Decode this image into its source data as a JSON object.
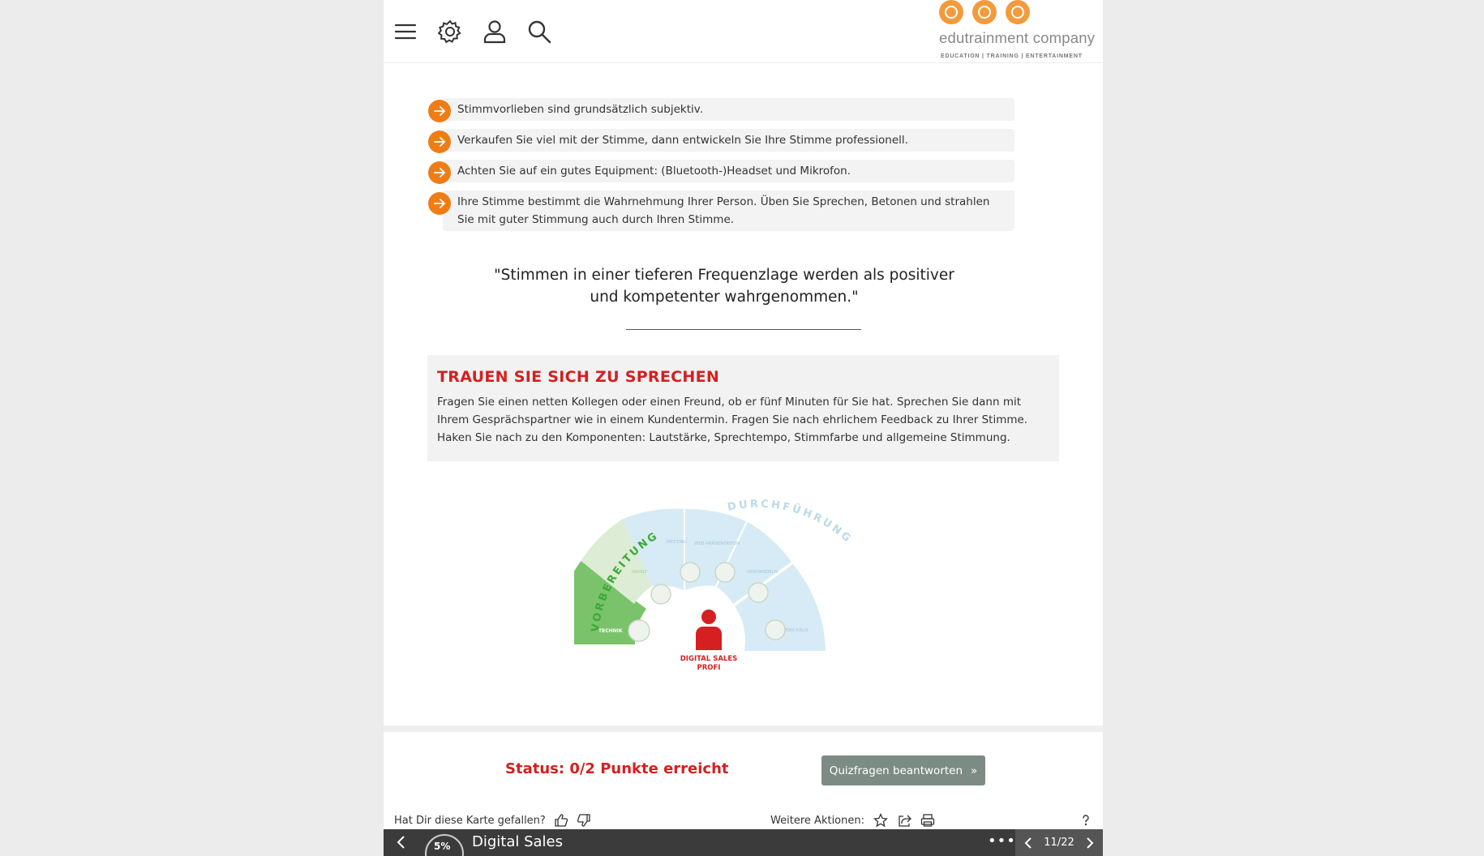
{
  "header": {
    "icons": [
      "menu-icon",
      "gear-icon",
      "user-icon",
      "search-icon"
    ],
    "logo": {
      "name": "edutrainment company",
      "tagline": "EDUCATION | TRAINING | ENTERTAINMENT"
    }
  },
  "bullets": [
    "Stimmvorlieben sind grundsätzlich subjektiv.",
    "Verkaufen Sie viel mit der Stimme, dann entwickeln Sie Ihre Stimme professionell.",
    "Achten Sie auf ein gutes Equipment: (Bluetooth-)Headset und Mikrofon.",
    "Ihre Stimme bestimmt die Wahrnehmung Ihrer Person. Üben Sie Sprechen, Betonen und strahlen Sie mit guter Stimmung auch durch Ihren Stimme."
  ],
  "quote": {
    "line1": "\"Stimmen in einer tieferen Frequenzlage werden als positiver",
    "line2": "und kompetenter wahrgenommen.\""
  },
  "infobox": {
    "title": "TRAUEN SIE SICH ZU SPRECHEN",
    "text": "Fragen Sie einen netten Kollegen oder einen Freund, ob er fünf Minuten für Sie hat. Sprechen Sie dann mit Ihrem Gesprächspartner wie in einem Kundentermin. Fragen Sie nach ehrlichem Feedback zu Ihrer Stimme. Haken Sie nach zu den Komponenten: Lautstärke, Sprechtempo, Stimmfarbe und allgemeine Stimmung."
  },
  "diagram": {
    "arc_left": "VORBEREITUNG",
    "arc_right": "DURCHFÜHRUNG",
    "segments": [
      "TECHNIK",
      "INHALT",
      "MEETING",
      "WEB-PRÄSENTATION",
      "VERHANDELN",
      "ENTWICKELN"
    ],
    "center_line1": "DIGITAL SALES",
    "center_line2": "PROFI",
    "colors": {
      "technik": "#7ac36a",
      "inhalt": "#dcecd5",
      "blue": "#d6ebf5",
      "red": "#d42020",
      "green_text": "#3daa35"
    }
  },
  "status": {
    "text": "Status: 0/2 Punkte erreicht",
    "quiz_button": "Quizfragen beantworten"
  },
  "feedback": {
    "question": "Hat Dir diese Karte gefallen?",
    "actions_label": "Weitere Aktionen:"
  },
  "bottombar": {
    "progress": "5%",
    "title": "Digital Sales",
    "more": "•••",
    "page": "11/22"
  },
  "colors": {
    "accent_orange": "#ef7d16",
    "status_red": "#d42020",
    "button_gray": "#7c8c84",
    "bar_dark": "#3b3b3b"
  }
}
